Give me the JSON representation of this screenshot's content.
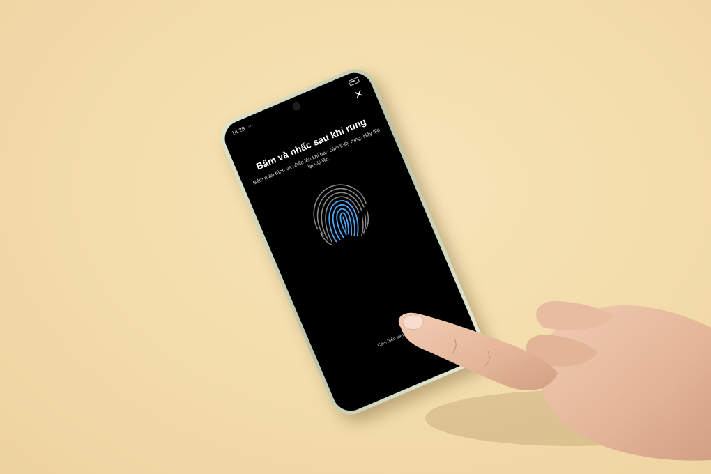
{
  "status_bar": {
    "time": "14:28",
    "more_dots": "···"
  },
  "icons": {
    "close": "close-icon",
    "fingerprint": "fingerprint-icon",
    "battery": "battery-icon",
    "camera": "front-camera"
  },
  "enroll": {
    "title": "Bấm và nhấc sau khi rung",
    "subtitle": "Bấm màn hình và nhấc lên khi bạn cảm thấy rung. Hãy lặp lại vài lần.",
    "sensor_label": "Cảm biến vân tay",
    "close_glyph": "✕"
  },
  "colors": {
    "background": "#f3dcab",
    "screen": "#000000",
    "fingerprint_active": "#4aa3f0",
    "fingerprint_inactive": "#8a8a8a"
  }
}
